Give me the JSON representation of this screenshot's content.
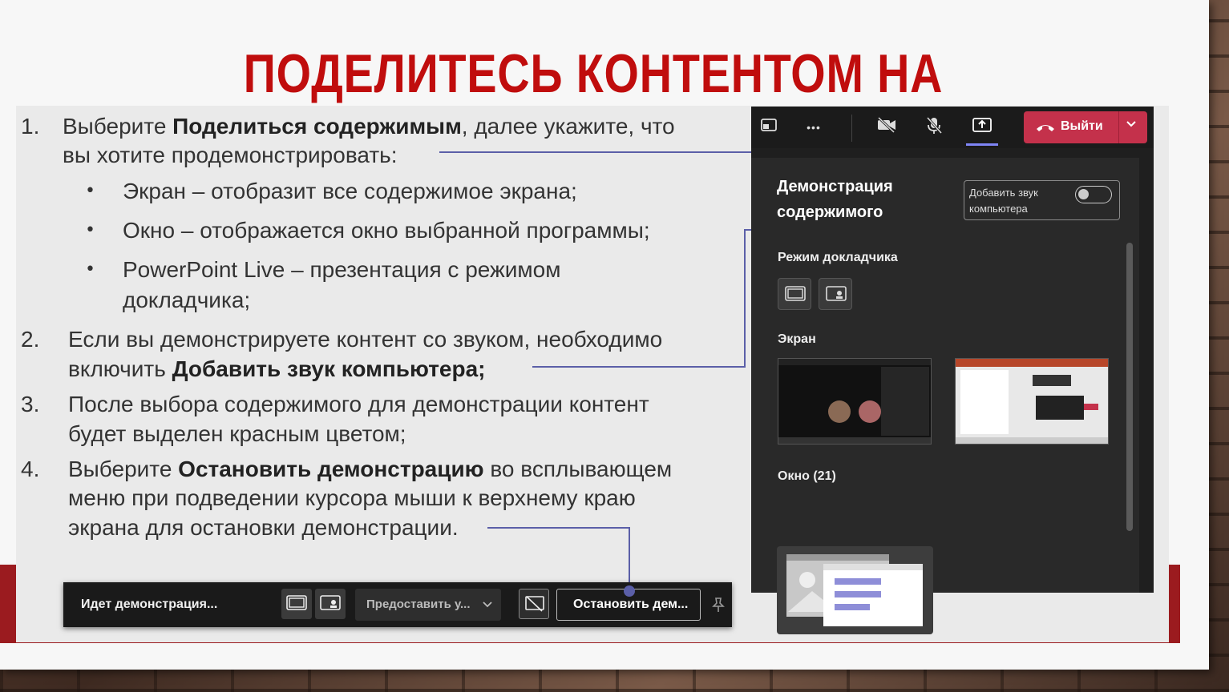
{
  "slide": {
    "title": "ПОДЕЛИТЕСЬ КОНТЕНТОМ НА СОБРАНИИ:"
  },
  "steps": [
    {
      "num": "1.",
      "pre": "Выберите ",
      "bold": "Поделиться содержимым",
      "post": ", далее укажите, что",
      "line2": "вы хотите продемонстрировать:"
    },
    {
      "num": "2.",
      "line1": "Если вы демонстрируете контент со звуком, необходимо",
      "pre": "включить ",
      "bold": "Добавить звук компьютера;"
    },
    {
      "num": "3.",
      "line1": "После выбора содержимого для демонстрации контент",
      "line2": "будет выделен красным цветом;"
    },
    {
      "num": "4.",
      "pre": "Выберите ",
      "bold": "Остановить демонстрацию",
      "post": " во всплывающем",
      "line2": "меню при подведении курсора мыши к верхнему краю",
      "line3": "экрана для остановки демонстрации."
    }
  ],
  "bullets": [
    "Экран – отобразит все содержимое экрана;",
    "Окно – отображается окно выбранной программы;",
    "PowerPoint Live – презентация с режимом",
    "докладчика;"
  ],
  "bullet_char": "•",
  "teams": {
    "leave_label": "Выйти",
    "more_glyph": "•••",
    "panel_title_1": "Демонстрация",
    "panel_title_2": "содержимого",
    "toggle_label": "Добавить звук компьютера",
    "presenter_mode_label": "Режим докладчика",
    "screen_label": "Экран",
    "window_label": "Окно (21)"
  },
  "sharebar": {
    "status": "Идет демонстрация...",
    "give_control": "Предоставить у...",
    "stop": "Остановить дем..."
  },
  "colors": {
    "title_red": "#c00d0d",
    "band_red": "#9b1b1f",
    "connector": "#5b5fa8",
    "leave_red": "#c4314b",
    "accent": "#7f85f5"
  }
}
